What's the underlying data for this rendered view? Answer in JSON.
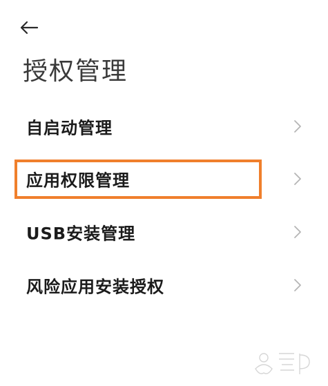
{
  "header": {
    "back_icon": "arrow-left-icon",
    "title": "授权管理"
  },
  "menu": {
    "items": [
      {
        "label": "自启动管理",
        "icon": "chevron-right-icon",
        "highlighted": false
      },
      {
        "label": "应用权限管理",
        "icon": "chevron-right-icon",
        "highlighted": true
      },
      {
        "label": "USB安装管理",
        "icon": "chevron-right-icon",
        "highlighted": false
      },
      {
        "label": "风险应用安装授权",
        "icon": "chevron-right-icon",
        "highlighted": false
      }
    ]
  },
  "annotation": {
    "highlight_color": "#f07f2c"
  },
  "colors": {
    "background": "#ffffff",
    "text": "#1b1b1b",
    "title": "#3a3a3a",
    "chevron": "#b5b5b5"
  }
}
